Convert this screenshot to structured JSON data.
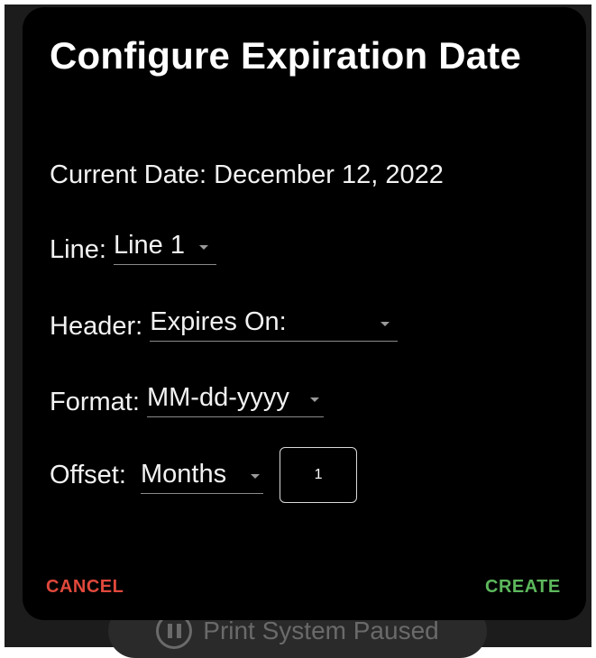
{
  "background": {
    "status_text": "Print System Paused"
  },
  "dialog": {
    "title": "Configure Expiration Date",
    "current_date_label": "Current Date: December 12, 2022",
    "line": {
      "label": "Line: ",
      "value": "Line 1"
    },
    "header": {
      "label": "Header: ",
      "value": "Expires On:"
    },
    "format": {
      "label": "Format: ",
      "value": "MM-dd-yyyy"
    },
    "offset": {
      "label": "Offset:  ",
      "unit_value": "Months",
      "amount": "1"
    },
    "cancel_label": "CANCEL",
    "create_label": "CREATE"
  },
  "colors": {
    "cancel": "#e0483c",
    "create": "#5cb85c",
    "dialog_bg": "#000000"
  }
}
